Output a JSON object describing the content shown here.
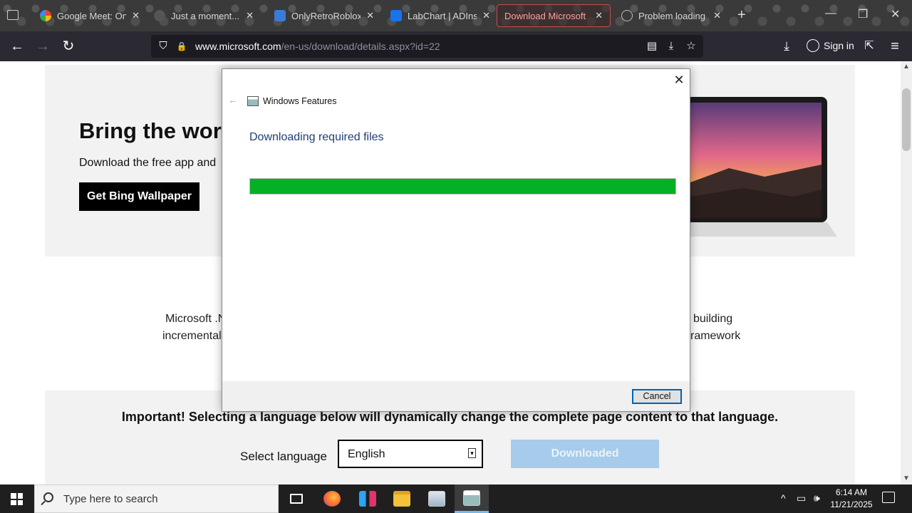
{
  "browser": {
    "tabs": [
      {
        "title": "Google Meet: Online",
        "icon_color": "#4285f4"
      },
      {
        "title": "Just a moment...",
        "icon_color": "#555555"
      },
      {
        "title": "OnlyRetroRobloxHe",
        "icon_color": "#3a7bd5"
      },
      {
        "title": "LabChart | ADInstru",
        "icon_color": "#1a73e8"
      },
      {
        "title": "Download Microsoft .N",
        "icon_color": "#e0e0e0"
      },
      {
        "title": "Problem loading pa",
        "icon_color": "#bbbbbb"
      }
    ],
    "tab_close_glyph": "✕",
    "new_tab_glyph": "+",
    "window_controls": {
      "minimize": "—",
      "restore": "❐",
      "close": "✕"
    },
    "url_host": "www.microsoft.com",
    "url_path": "/en-us/download/details.aspx?id=22",
    "signin_label": "Sign in",
    "nav": {
      "back": "←",
      "forward": "→",
      "reload": "↻"
    },
    "icons": {
      "shield": "⛉",
      "lock": "🔒",
      "reader": "▤",
      "save": "⤓",
      "star": "☆",
      "download": "⤓",
      "extensions": "⇱",
      "menu": "≡"
    }
  },
  "page": {
    "hero_title": "Bring the world",
    "hero_subtitle": "Download the free app and",
    "bing_button": "Get Bing Wallpaper",
    "desc_line1_left": "Microsoft .N",
    "desc_line1_right": "building",
    "desc_line2_left": "incremental",
    "desc_line2_right": "ramework",
    "important_notice": "Important! Selecting a language below will dynamically change the complete page content to that language.",
    "select_language_label": "Select language",
    "selected_language": "English",
    "download_button": "Downloaded"
  },
  "dialog": {
    "title": "Windows Features",
    "heading": "Downloading required files",
    "progress": 1.0,
    "progress_color": "#06b025",
    "cancel_label": "Cancel",
    "close_glyph": "✕",
    "back_glyph": "←"
  },
  "taskbar": {
    "search_placeholder": "Type here to search",
    "time": "6:14 AM",
    "date": "11/21/2025",
    "tray_icons": {
      "chevron": "^",
      "network": "▭",
      "volume": "🕪"
    }
  },
  "colors": {
    "accent_green": "#06b025",
    "heading_blue": "#1e3f78",
    "download_button_disabled": "#a7cbea"
  }
}
